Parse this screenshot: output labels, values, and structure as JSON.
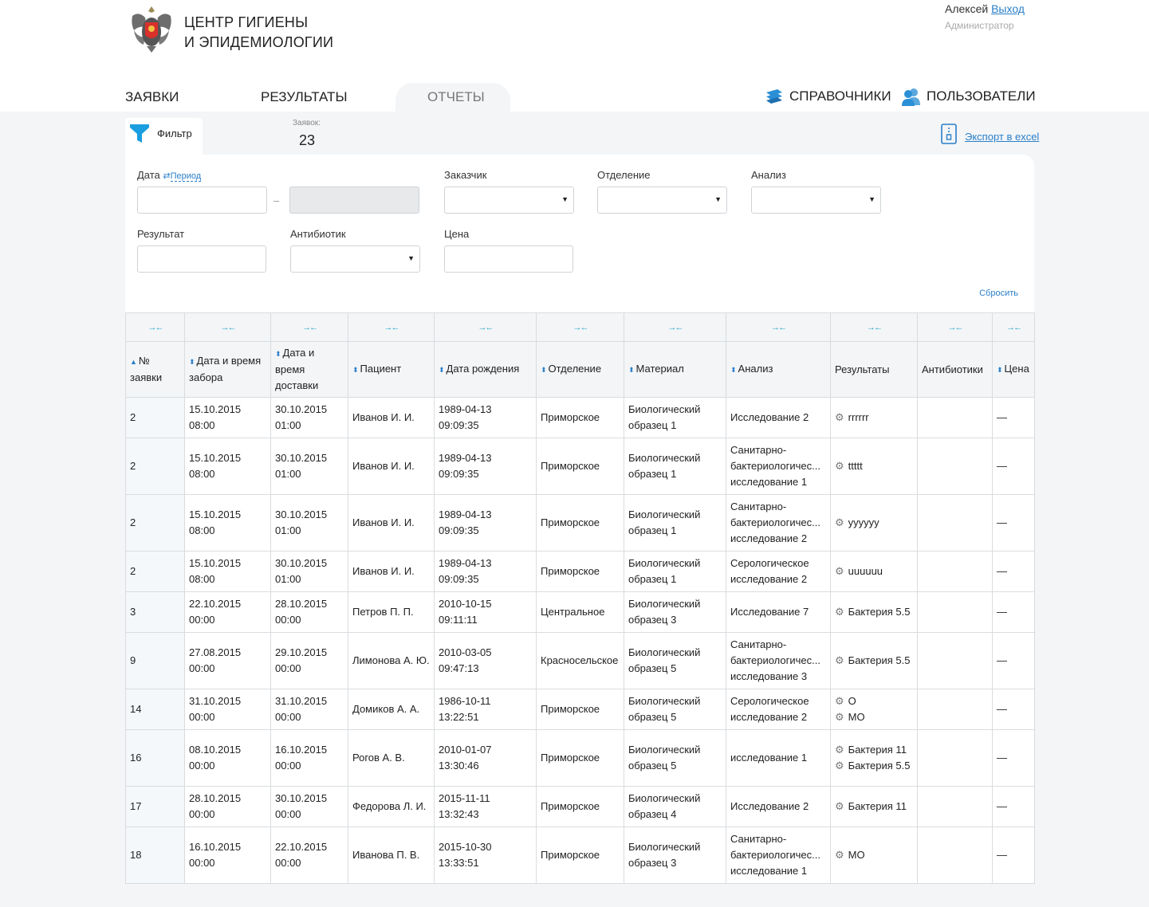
{
  "header": {
    "title_line1": "ЦЕНТР ГИГИЕНЫ",
    "title_line2": "И ЭПИДЕМИОЛОГИИ",
    "user_name": "Алексей",
    "logout_label": "Выход",
    "role": "Администратор"
  },
  "nav": {
    "requests": "ЗАЯВКИ",
    "results": "РЕЗУЛЬТАТЫ",
    "reports": "ОТЧЕТЫ",
    "directories": "СПРАВОЧНИКИ",
    "users": "ПОЛЬЗОВАТЕЛИ"
  },
  "toolbar": {
    "filter_label": "Фильтр",
    "count_label": "Заявок:",
    "count_value": "23",
    "export_label": "Экспорт в excel"
  },
  "filter": {
    "date_label": "Дата",
    "period_label": "Период",
    "customer_label": "Заказчик",
    "department_label": "Отделение",
    "analysis_label": "Анализ",
    "result_label": "Результат",
    "antibiotic_label": "Антибиотик",
    "price_label": "Цена",
    "date_separator": "–",
    "reset_label": "Сбросить"
  },
  "table": {
    "resize_glyph": "→←",
    "columns": [
      "№ заявки",
      "Дата и время забора",
      "Дата и время доставки",
      "Пациент",
      "Дата рождения",
      "Отделение",
      "Материал",
      "Анализ",
      "Результаты",
      "Антибиотики",
      "Цена"
    ],
    "rows": [
      {
        "num": "2",
        "taken": "15.10.2015 08:00",
        "delivered": "30.10.2015 01:00",
        "patient": "Иванов И. И.",
        "birth": "1989-04-13 09:09:35",
        "dept": "Приморское",
        "material": "Биологический образец 1",
        "analysis": "Исследование 2",
        "results": [
          "rrrrrr"
        ],
        "antibiotics": "",
        "price": "—"
      },
      {
        "num": "2",
        "taken": "15.10.2015 08:00",
        "delivered": "30.10.2015 01:00",
        "patient": "Иванов И. И.",
        "birth": "1989-04-13 09:09:35",
        "dept": "Приморское",
        "material": "Биологический образец 1",
        "analysis": "Санитарно-бактериологичес... исследование 1",
        "results": [
          "ttttt"
        ],
        "antibiotics": "",
        "price": "—"
      },
      {
        "num": "2",
        "taken": "15.10.2015 08:00",
        "delivered": "30.10.2015 01:00",
        "patient": "Иванов И. И.",
        "birth": "1989-04-13 09:09:35",
        "dept": "Приморское",
        "material": "Биологический образец 1",
        "analysis": "Санитарно-бактериологичес... исследование 2",
        "results": [
          "yyyyyy"
        ],
        "antibiotics": "",
        "price": "—"
      },
      {
        "num": "2",
        "taken": "15.10.2015 08:00",
        "delivered": "30.10.2015 01:00",
        "patient": "Иванов И. И.",
        "birth": "1989-04-13 09:09:35",
        "dept": "Приморское",
        "material": "Биологический образец 1",
        "analysis": "Серологическое исследование 2",
        "results": [
          "uuuuuu"
        ],
        "antibiotics": "",
        "price": "—"
      },
      {
        "num": "3",
        "taken": "22.10.2015 00:00",
        "delivered": "28.10.2015 00:00",
        "patient": "Петров П. П.",
        "birth": "2010-10-15 09:11:11",
        "dept": "Центральное",
        "material": "Биологический образец 3",
        "analysis": "Исследование 7",
        "results": [
          "Бактерия 5.5"
        ],
        "antibiotics": "",
        "price": "—"
      },
      {
        "num": "9",
        "taken": "27.08.2015 00:00",
        "delivered": "29.10.2015 00:00",
        "patient": "Лимонова А. Ю.",
        "birth": "2010-03-05 09:47:13",
        "dept": "Красносельское",
        "material": "Биологический образец 5",
        "analysis": "Санитарно-бактериологичес... исследование 3",
        "results": [
          "Бактерия 5.5"
        ],
        "antibiotics": "",
        "price": "—"
      },
      {
        "num": "14",
        "taken": "31.10.2015 00:00",
        "delivered": "31.10.2015 00:00",
        "patient": "Домиков А. А.",
        "birth": "1986-10-11 13:22:51",
        "dept": "Приморское",
        "material": "Биологический образец 5",
        "analysis": "Серологическое исследование 2",
        "results": [
          "O",
          "МО"
        ],
        "antibiotics": "",
        "price": "—"
      },
      {
        "num": "16",
        "taken": "08.10.2015 00:00",
        "delivered": "16.10.2015 00:00",
        "patient": "Рогов А. В.",
        "birth": "2010-01-07 13:30:46",
        "dept": "Приморское",
        "material": "Биологический образец 5",
        "analysis": "исследование 1",
        "results": [
          "Бактерия 11",
          "Бактерия 5.5"
        ],
        "antibiotics": "",
        "price": "—"
      },
      {
        "num": "17",
        "taken": "28.10.2015 00:00",
        "delivered": "30.10.2015 00:00",
        "patient": "Федорова Л. И.",
        "birth": "2015-11-11 13:32:43",
        "dept": "Приморское",
        "material": "Биологический образец 4",
        "analysis": "Исследование 2",
        "results": [
          "Бактерия 11"
        ],
        "antibiotics": "",
        "price": "—"
      },
      {
        "num": "18",
        "taken": "16.10.2015 00:00",
        "delivered": "22.10.2015 00:00",
        "patient": "Иванова П. В.",
        "birth": "2015-10-30 13:33:51",
        "dept": "Приморское",
        "material": "Биологический образец 3",
        "analysis": "Санитарно-бактериологичес... исследование 1",
        "results": [
          "МО"
        ],
        "antibiotics": "",
        "price": "—"
      }
    ]
  },
  "icons": {
    "logo": "coat-of-arms-logo",
    "directories": "books-icon",
    "users": "users-icon",
    "filter": "funnel-icon",
    "export": "excel-file-icon",
    "result": "gear-icon"
  },
  "colors": {
    "accent": "#2a7fc9",
    "accent_light": "#26a5c9"
  }
}
